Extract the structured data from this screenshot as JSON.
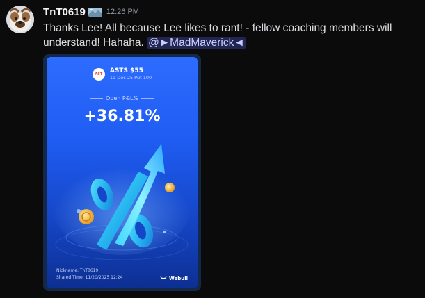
{
  "message": {
    "username": "TnT0619",
    "timestamp": "12:26 PM",
    "text": "Thanks Lee!  All because Lee likes to rant! - fellow coaching members will understand!  Hahaha. ",
    "mention": "@►MadMaverick◄"
  },
  "card": {
    "logo_text": "AST",
    "ticker": "ASTS $55",
    "contract": "19 Dec 25 Put 100",
    "pl_label": "Open P&L%",
    "pl_value": "+36.81%",
    "nickname": "Nickname: TnT0619",
    "shared_time": "Shared Time: 11/20/2025 12:24",
    "brand": "Webull"
  },
  "colors": {
    "background": "#0b0b0c",
    "mention_bg": "#3b3f8a",
    "card_top": "#2e6cff",
    "card_bottom": "#0d2f92"
  }
}
